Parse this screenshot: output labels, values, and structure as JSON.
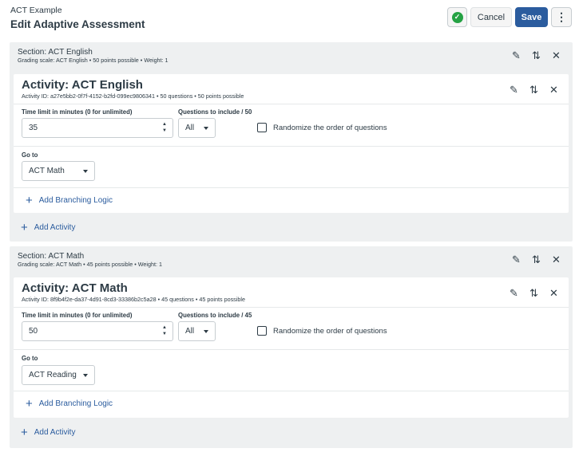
{
  "header": {
    "breadcrumb": "ACT Example",
    "title": "Edit Adaptive Assessment",
    "cancel_label": "Cancel",
    "save_label": "Save",
    "more_label": "⋮"
  },
  "labels": {
    "time_limit": "Time limit in minutes (0 for unlimited)",
    "goto": "Go to",
    "randomize": "Randomize the order of questions",
    "add_branching": "Add Branching Logic",
    "add_activity": "Add Activity"
  },
  "sections": [
    {
      "title": "Section: ACT English",
      "meta": "Grading scale: ACT English  •  50 points possible  •  Weight: 1",
      "activity": {
        "title": "Activity: ACT English",
        "meta": "Activity ID: a27e5bb2-0f7f-4152-b2fd-099ec9806341  •  50 questions  •  50 points possible",
        "time_limit_value": "35",
        "questions_label": "Questions to include / 50",
        "questions_value": "All",
        "goto_value": "ACT Math"
      }
    },
    {
      "title": "Section: ACT Math",
      "meta": "Grading scale: ACT Math  •  45 points possible  •  Weight: 1",
      "activity": {
        "title": "Activity: ACT Math",
        "meta": "Activity ID: 8f9b4f2e-da37-4d91-8cd3-33386b2c5a28  •  45 questions  •  45 points possible",
        "time_limit_value": "50",
        "questions_label": "Questions to include / 45",
        "questions_value": "All",
        "goto_value": "ACT Reading"
      }
    }
  ]
}
